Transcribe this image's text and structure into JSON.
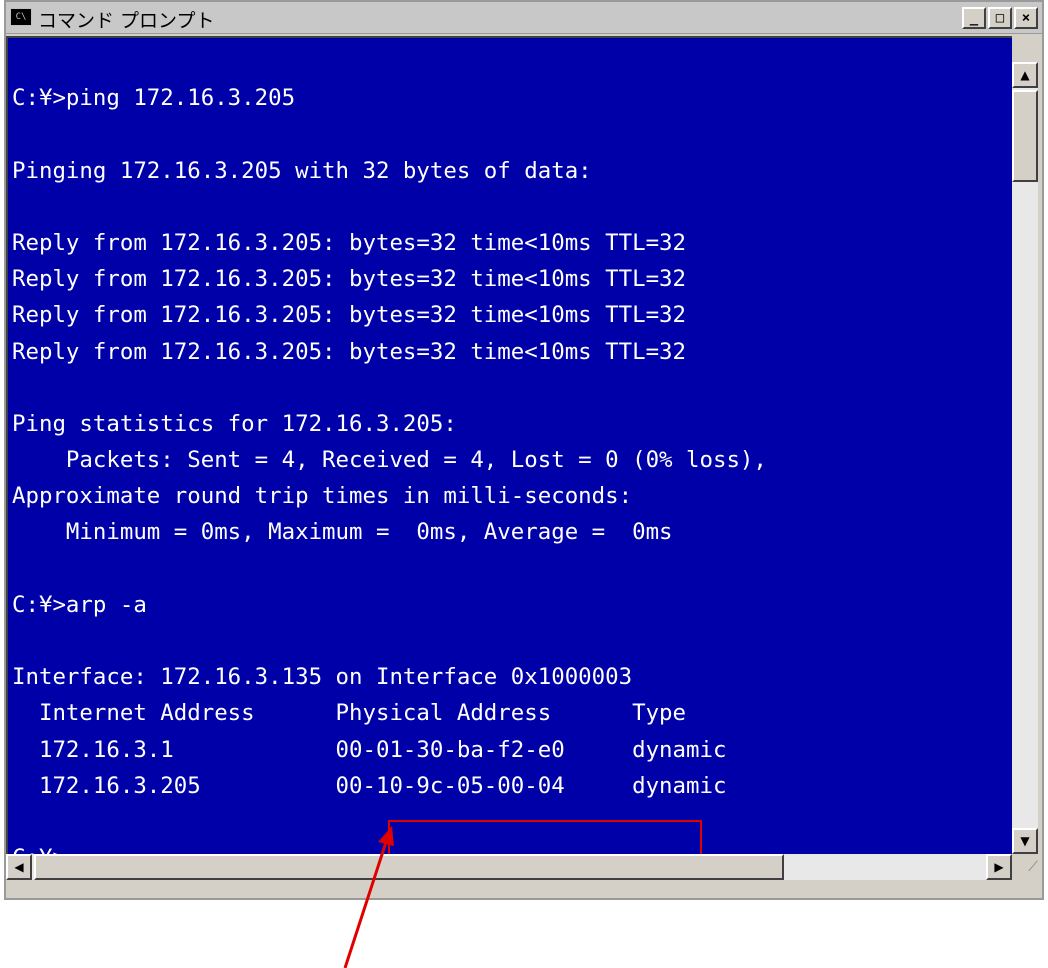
{
  "window": {
    "title": "コマンド プロンプト",
    "icon": "C\\",
    "buttons": {
      "minimize": "_",
      "maximize": "□",
      "close": "×"
    }
  },
  "console": {
    "lines": [
      "",
      "C:¥>ping 172.16.3.205",
      "",
      "Pinging 172.16.3.205 with 32 bytes of data:",
      "",
      "Reply from 172.16.3.205: bytes=32 time<10ms TTL=32",
      "Reply from 172.16.3.205: bytes=32 time<10ms TTL=32",
      "Reply from 172.16.3.205: bytes=32 time<10ms TTL=32",
      "Reply from 172.16.3.205: bytes=32 time<10ms TTL=32",
      "",
      "Ping statistics for 172.16.3.205:",
      "    Packets: Sent = 4, Received = 4, Lost = 0 (0% loss),",
      "Approximate round trip times in milli-seconds:",
      "    Minimum = 0ms, Maximum =  0ms, Average =  0ms",
      "",
      "C:¥>arp -a",
      "",
      "Interface: 172.16.3.135 on Interface 0x1000003",
      "  Internet Address      Physical Address      Type",
      "  172.16.3.1            00-01-30-ba-f2-e0     dynamic",
      "  172.16.3.205          00-10-9c-05-00-04     dynamic",
      "",
      "C:¥>"
    ]
  },
  "colors": {
    "console_bg": "#0000a8",
    "console_text": "#ffffff",
    "cursor": "#ffd700",
    "annotation": "#e00000"
  },
  "scrollbars": {
    "up_arrow": "▲",
    "down_arrow": "▼",
    "left_arrow": "◀",
    "right_arrow": "▶",
    "grip": "⟋"
  }
}
